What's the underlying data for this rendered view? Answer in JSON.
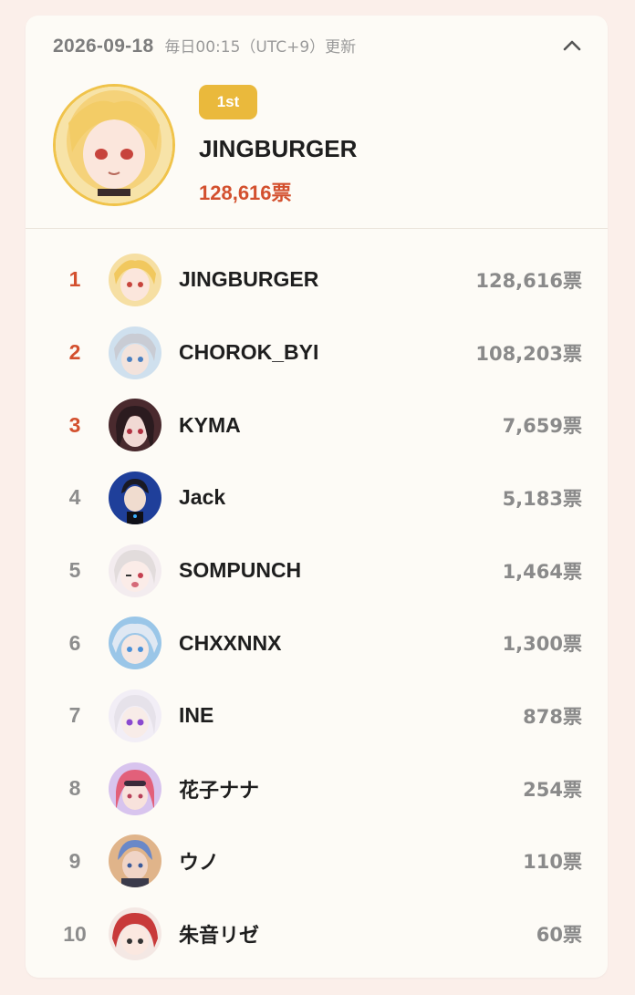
{
  "header": {
    "date": "2026-09-18",
    "update_note": "毎日00:15（UTC+9）更新"
  },
  "winner": {
    "badge": "1st",
    "name": "JINGBURGER",
    "votes": "128,616票"
  },
  "colors": {
    "accent": "#d3502e",
    "badge": "#eab93c",
    "background": "#fbefea",
    "card": "#fdfbf6"
  },
  "rankings": [
    {
      "rank": "1",
      "name": "JINGBURGER",
      "votes": "128,616票"
    },
    {
      "rank": "2",
      "name": "CHOROK_BYI",
      "votes": "108,203票"
    },
    {
      "rank": "3",
      "name": "KYMA",
      "votes": "7,659票"
    },
    {
      "rank": "4",
      "name": "Jack",
      "votes": "5,183票"
    },
    {
      "rank": "5",
      "name": "SOMPUNCH",
      "votes": "1,464票"
    },
    {
      "rank": "6",
      "name": "CHXXNNX",
      "votes": "1,300票"
    },
    {
      "rank": "7",
      "name": "INE",
      "votes": "878票"
    },
    {
      "rank": "8",
      "name": "花子ナナ",
      "votes": "254票"
    },
    {
      "rank": "9",
      "name": "ウノ",
      "votes": "110票"
    },
    {
      "rank": "10",
      "name": "朱音リゼ",
      "votes": "60票"
    }
  ]
}
